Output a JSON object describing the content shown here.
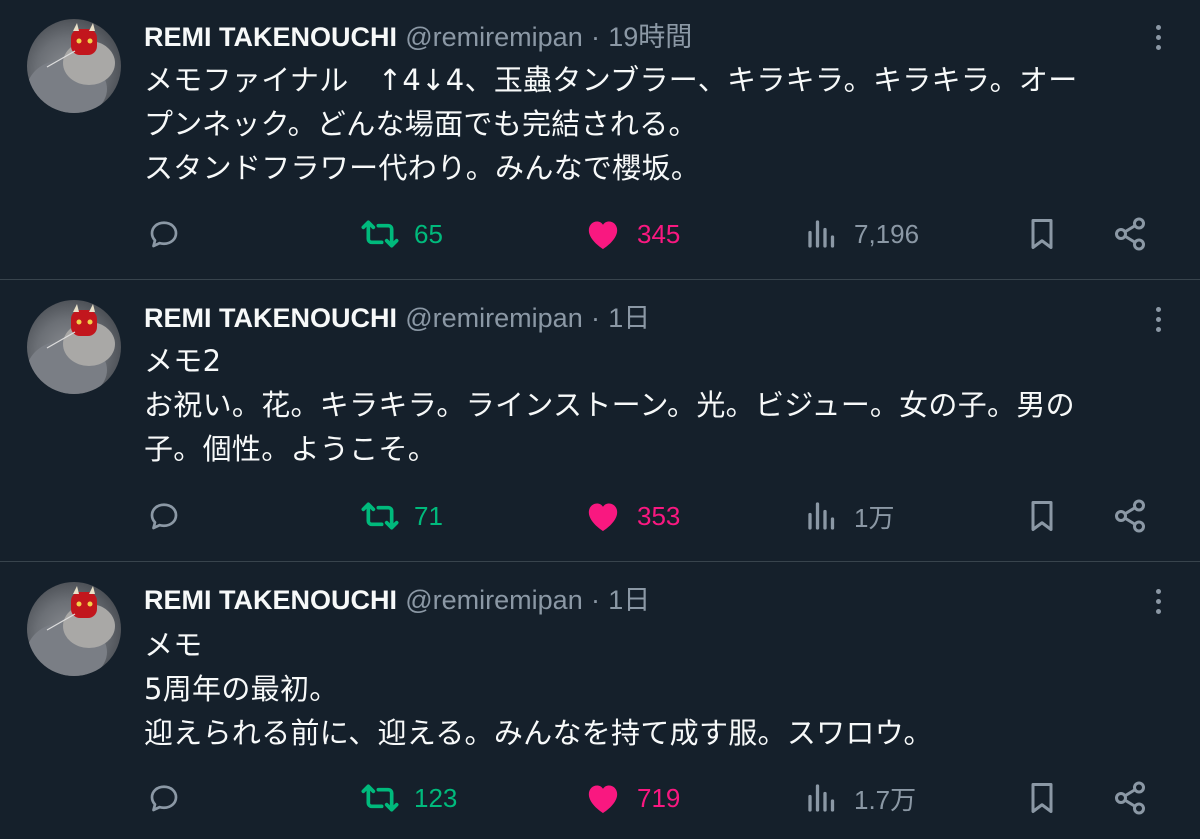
{
  "colors": {
    "background": "#15202b",
    "text": "#f7f9f9",
    "muted": "#8b98a5",
    "retweet": "#00ba7c",
    "like": "#f91880",
    "divider": "#38444d"
  },
  "tweets": [
    {
      "name": "REMI TAKENOUCHI",
      "handle": "@remiremipan",
      "separator": "·",
      "time": "19時間",
      "lines": [
        "メモファイナル　↑4↓4、玉蟲タンブラー、キラキラ。キラキラ。オー",
        "プンネック。どんな場面でも完結される。",
        "スタンドフラワー代わり。みんなで櫻坂。"
      ],
      "retweets": "65",
      "likes": "345",
      "views": "7,196",
      "icons": [
        "reply-icon",
        "retweet-icon",
        "heart-icon",
        "views-icon",
        "bookmark-icon",
        "share-icon",
        "more-icon"
      ]
    },
    {
      "name": "REMI TAKENOUCHI",
      "handle": "@remiremipan",
      "separator": "·",
      "time": "1日",
      "lines": [
        "メモ2",
        "お祝い。花。キラキラ。ラインストーン。光。ビジュー。女の子。男の",
        "子。個性。ようこそ。"
      ],
      "retweets": "71",
      "likes": "353",
      "views": "1万",
      "icons": [
        "reply-icon",
        "retweet-icon",
        "heart-icon",
        "views-icon",
        "bookmark-icon",
        "share-icon",
        "more-icon"
      ]
    },
    {
      "name": "REMI TAKENOUCHI",
      "handle": "@remiremipan",
      "separator": "·",
      "time": "1日",
      "lines": [
        "メモ",
        "5周年の最初。",
        "迎えられる前に、迎える。みんなを持て成す服。スワロウ。"
      ],
      "retweets": "123",
      "likes": "719",
      "views": "1.7万",
      "icons": [
        "reply-icon",
        "retweet-icon",
        "heart-icon",
        "views-icon",
        "bookmark-icon",
        "share-icon",
        "more-icon"
      ]
    }
  ]
}
